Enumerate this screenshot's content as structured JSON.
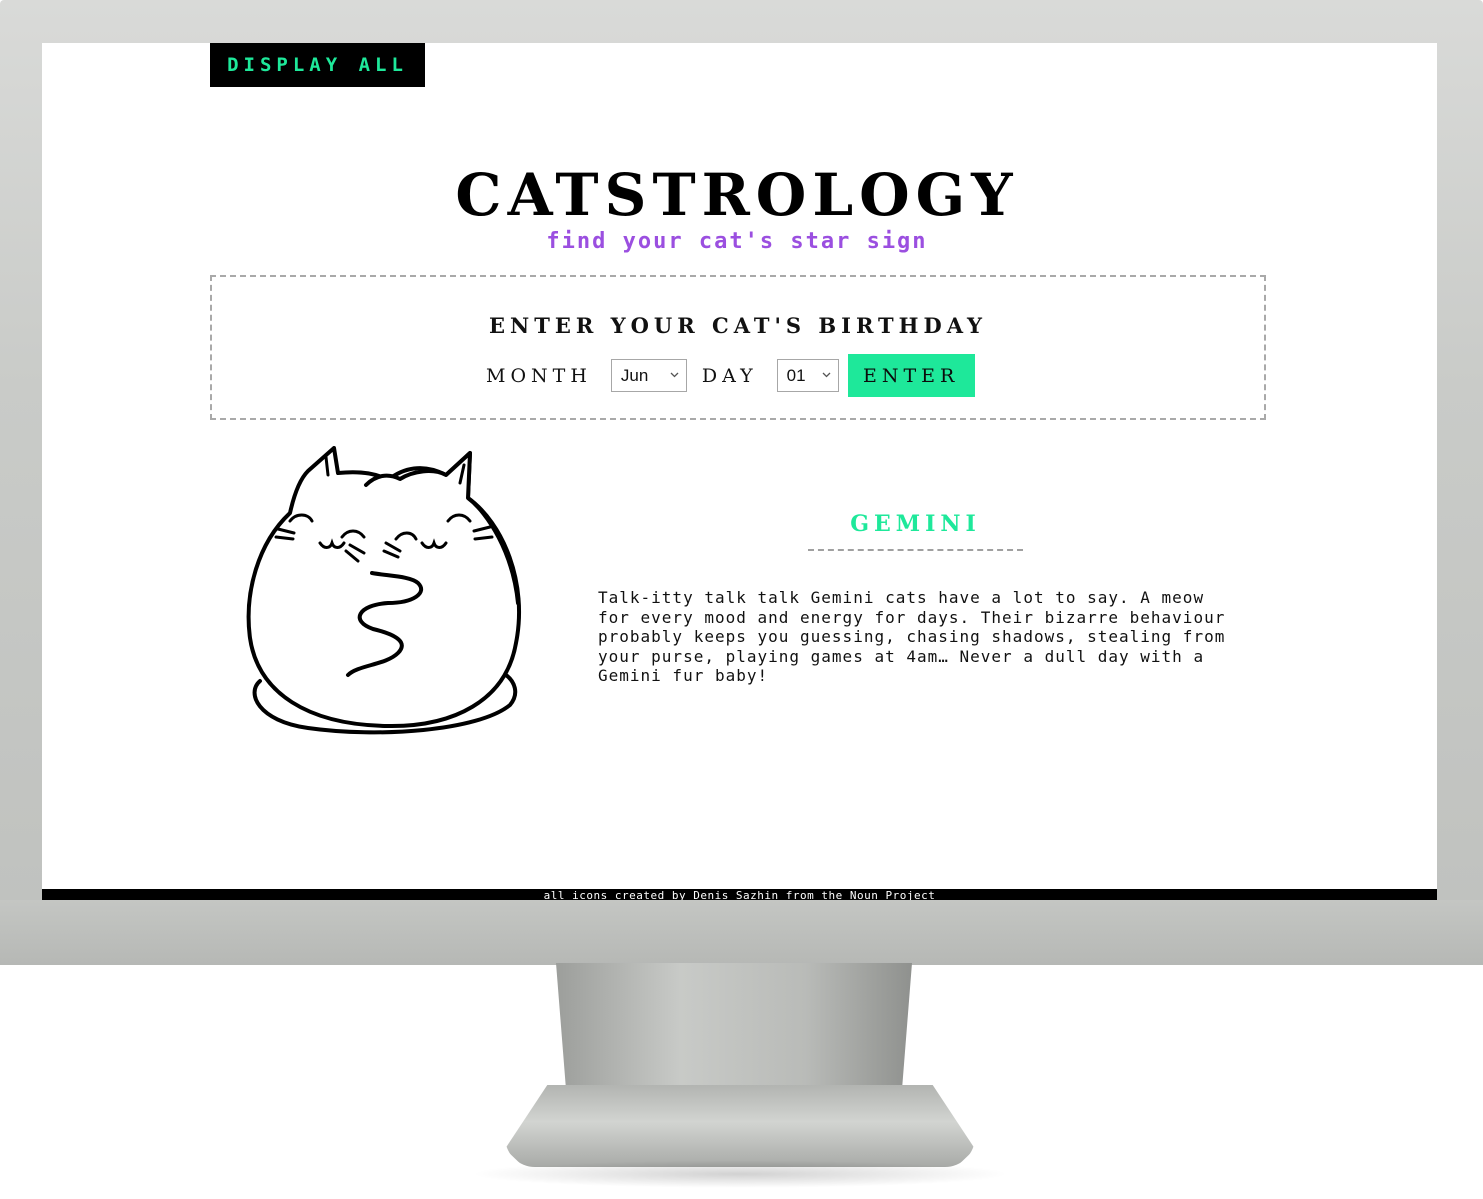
{
  "header": {
    "display_all_label": "DISPLAY ALL"
  },
  "hero": {
    "title": "CATSTROLOGY",
    "subtitle": "find your cat's star sign"
  },
  "form": {
    "heading": "ENTER YOUR CAT'S BIRTHDAY",
    "month_label": "MONTH",
    "month_value": "Jun",
    "day_label": "DAY",
    "day_value": "01",
    "enter_label": "ENTER"
  },
  "result": {
    "sign": "GEMINI",
    "description": "Talk-itty talk talk Gemini cats have a lot to say. A meow for every mood and energy for days. Their bizarre behaviour probably keeps you guessing, chasing shadows, stealing from your purse, playing games at 4am… Never a dull day with a Gemini fur baby!",
    "illustration_icon": "hugging-cats-icon"
  },
  "footer": {
    "credit": "all icons created by Denis Sazhin from the Noun Project"
  },
  "colors": {
    "accent_green": "#1ee89a",
    "accent_purple": "#9b4fe0",
    "black": "#000000"
  }
}
